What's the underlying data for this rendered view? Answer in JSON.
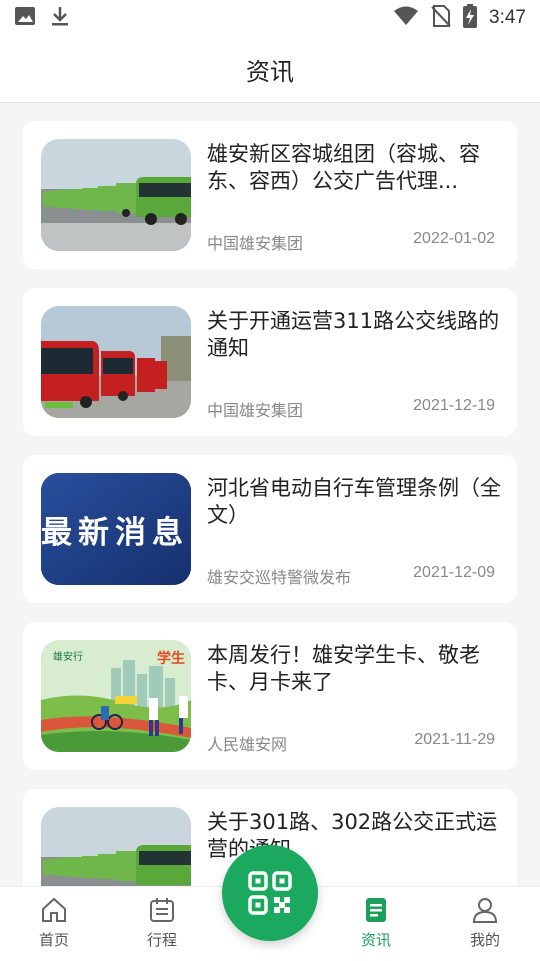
{
  "status_bar": {
    "time": "3:47",
    "icons": [
      "image-icon",
      "download-icon",
      "wifi-icon",
      "no-sim-icon",
      "battery-charging-icon"
    ]
  },
  "header": {
    "title": "资讯"
  },
  "news": [
    {
      "title": "雄安新区容城组团（容城、容东、容西）公交广告代理...",
      "source": "中国雄安集团",
      "date": "2022-01-02",
      "image": "green-buses-photo"
    },
    {
      "title": "关于开通运营311路公交线路的通知",
      "source": "中国雄安集团",
      "date": "2021-12-19",
      "image": "red-buses-photo"
    },
    {
      "title": "河北省电动自行车管理条例（全文）",
      "source": "雄安交巡特警微发布",
      "date": "2021-12-09",
      "image": "latest-news-banner",
      "image_text": "最新消息"
    },
    {
      "title": "本周发行！雄安学生卡、敬老卡、月卡来了",
      "source": "人民雄安网",
      "date": "2021-11-29",
      "image": "xiongan-cards-illustration",
      "image_text": "雄安行",
      "image_text2": "学生"
    },
    {
      "title": "关于301路、302路公交正式运营的通知",
      "source": "",
      "date": "",
      "image": "green-buses-photo"
    }
  ],
  "tabbar": {
    "tabs": [
      {
        "label": "首页",
        "icon": "home-icon"
      },
      {
        "label": "行程",
        "icon": "calendar-icon"
      },
      {
        "label": "资讯",
        "icon": "document-icon",
        "active": true
      },
      {
        "label": "我的",
        "icon": "person-icon"
      }
    ],
    "center_button_icon": "qr-code-icon"
  },
  "colors": {
    "accent": "#1aa05a",
    "background": "#f5f5f5",
    "card": "#ffffff"
  }
}
